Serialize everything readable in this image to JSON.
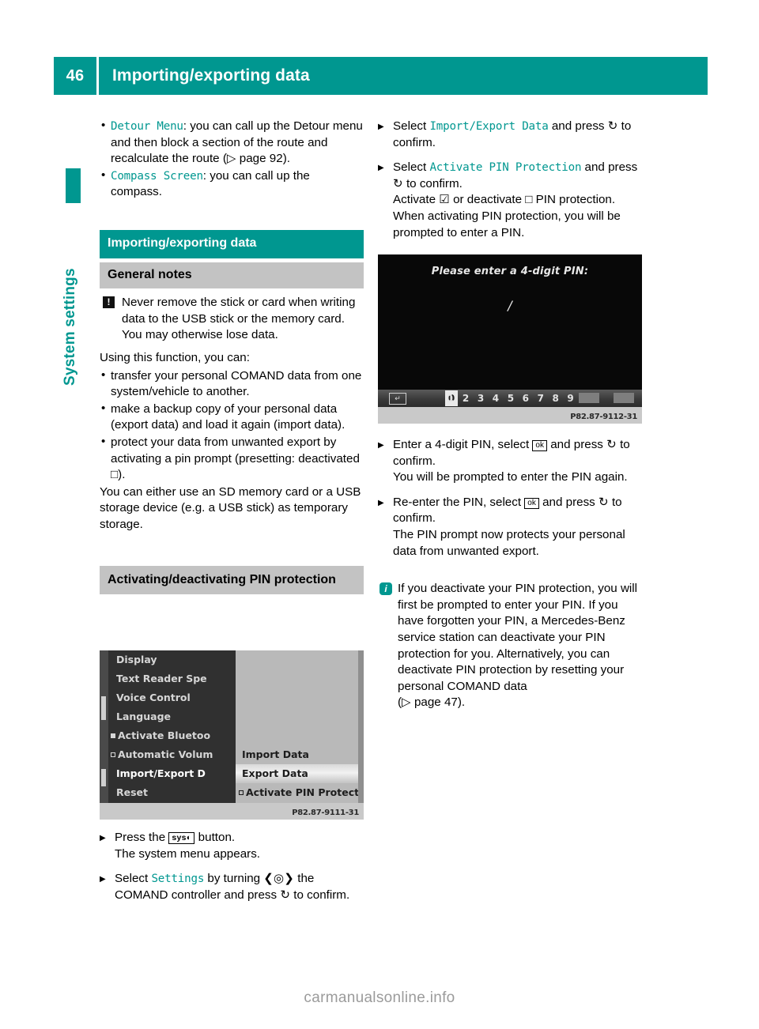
{
  "header": {
    "page_number": "46",
    "title": "Importing/exporting data",
    "accent_color": "#009790"
  },
  "sidebar": {
    "chapter_label": "System settings"
  },
  "left_column": {
    "bullets": [
      {
        "code": "Detour Menu",
        "text": ": you can call up the Detour menu and then block a section of the route and recalculate the route (▷ page 92)."
      },
      {
        "code": "Compass Screen",
        "text": ": you can call up the compass."
      }
    ],
    "section_bar": "Importing/exporting data",
    "subsection_bar": "General notes",
    "warning": {
      "icon": "warning-icon",
      "glyph": "!",
      "text": "Never remove the stick or card when writing data to the USB stick or the memory card. You may otherwise lose data."
    },
    "intro": "Using this function, you can:",
    "capabilities": [
      "transfer your personal COMAND data from one system/vehicle to another.",
      "make a backup copy of your personal data (export data) and load it again (import data).",
      "protect your data from unwanted export by activating a pin prompt (presetting: deactivated □)."
    ],
    "storage_note": "You can either use an SD memory card or a USB storage device (e.g. a USB stick) as temporary storage.",
    "pin_section_bar": "Activating/deactivating PIN protection",
    "steps": [
      {
        "pre": "Press the ",
        "button": "sys",
        "post": " button.",
        "result": "The system menu appears."
      },
      {
        "pre": "Select ",
        "code": "Settings",
        "post": " by turning ❮◎❯ the COMAND controller and press ↻ to confirm."
      }
    ]
  },
  "settings_screenshot": {
    "name": "comand-settings-menu",
    "left_menu": [
      {
        "label": "Display",
        "marker": "none"
      },
      {
        "label": "Text Reader Spe",
        "marker": "none"
      },
      {
        "label": "Voice Control",
        "marker": "none"
      },
      {
        "label": "Language",
        "marker": "none"
      },
      {
        "label": "Activate Bluetoo",
        "marker": "filled"
      },
      {
        "label": "Automatic Volum",
        "marker": "empty"
      },
      {
        "label": "Import/Export D",
        "marker": "none",
        "selected": true
      },
      {
        "label": "Reset",
        "marker": "none"
      }
    ],
    "right_menu": [
      {
        "label": "Import Data",
        "marker": "none",
        "highlighted": false
      },
      {
        "label": "Export Data",
        "marker": "none",
        "highlighted": true
      },
      {
        "label": "Activate PIN Protection",
        "marker": "dark",
        "highlighted": false
      }
    ],
    "caption": "P82.87-9111-31"
  },
  "right_column": {
    "steps": [
      {
        "pre": "Select ",
        "code": "Import/Export Data",
        "post": " and press ↻ to confirm."
      },
      {
        "pre": "Select ",
        "code": "Activate PIN Protection",
        "post": " and press ↻ to confirm.",
        "extra": "Activate ☑ or deactivate □ PIN protection. When activating PIN protection, you will be prompted to enter a PIN."
      }
    ],
    "steps2": [
      {
        "pre": "Enter a 4-digit PIN, select ",
        "button": "ok",
        "post": " and press ↻ to confirm.",
        "result": "You will be prompted to enter the PIN again."
      },
      {
        "pre": "Re-enter the PIN, select ",
        "button": "ok",
        "post": " and press ↻ to confirm.",
        "result": "The PIN prompt now protects your personal data from unwanted export."
      }
    ],
    "info": {
      "icon": "info-icon",
      "glyph": "i",
      "text": "If you deactivate your PIN protection, you will first be prompted to enter your PIN. If you have forgotten your PIN, a Mercedes-Benz service station can deactivate your PIN protection for you. Alternatively, you can deactivate PIN protection by resetting your personal COMAND data",
      "reference": "(▷ page 47)."
    }
  },
  "pin_screenshot": {
    "name": "comand-pin-entry",
    "prompt": "Please enter a 4-digit PIN:",
    "cursor": "/",
    "keypad_digits": "1 2 3 4 5 6 7 8 9",
    "selected_digit": "0",
    "back_icon": "↵",
    "caption": "P82.87-9112-31"
  },
  "footer": {
    "watermark": "carmanualsonline.info"
  }
}
